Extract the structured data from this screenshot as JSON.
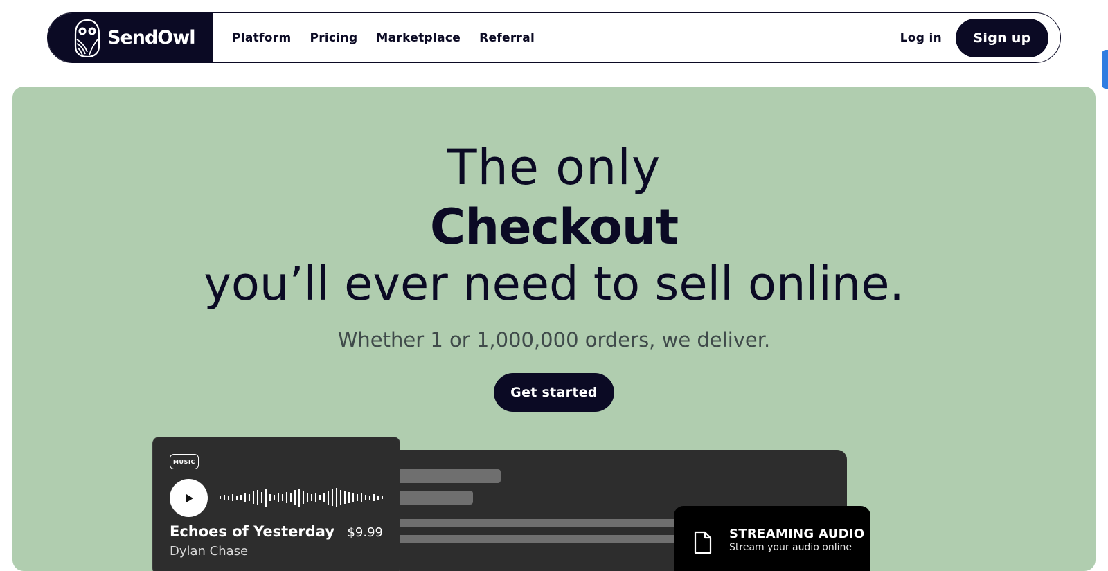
{
  "nav": {
    "brand": "SendOwl",
    "links": [
      "Platform",
      "Pricing",
      "Marketplace",
      "Referral"
    ],
    "login": "Log in",
    "signup": "Sign up"
  },
  "hero": {
    "line1": "The only",
    "line2": "Checkout",
    "line3": "you’ll ever need to sell online.",
    "subline": "Whether 1 or 1,000,000 orders, we deliver.",
    "cta": "Get started"
  },
  "music_card": {
    "badge": "MUSIC",
    "title": "Echoes of Yesterday",
    "price": "$9.99",
    "artist": "Dylan Chase"
  },
  "stream_card": {
    "title": "STREAMING AUDIO",
    "subtitle": "Stream your audio online"
  },
  "colors": {
    "brand_dark": "#0b0a24",
    "hero_bg": "#b0cdaf",
    "card_dark": "#2d2d2d",
    "accent_blue": "#2f7de1"
  },
  "icons": {
    "logo": "owl-logo-icon",
    "play": "play-icon",
    "waveform": "waveform-icon",
    "file": "file-icon"
  }
}
